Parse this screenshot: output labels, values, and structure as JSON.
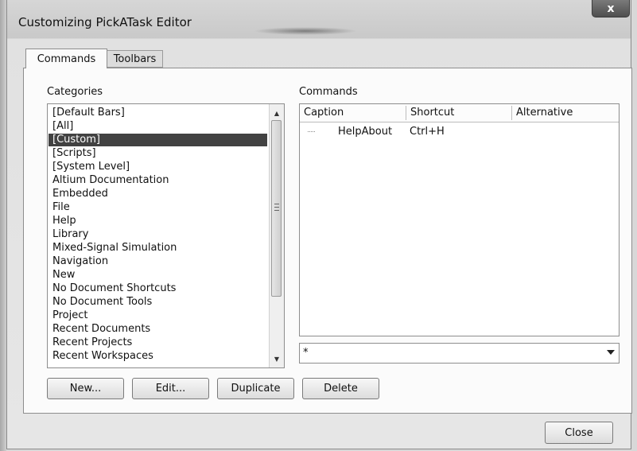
{
  "window": {
    "title": "Customizing PickATask Editor",
    "close_glyph": "x"
  },
  "tabs": [
    {
      "label": "Commands",
      "active": true
    },
    {
      "label": "Toolbars",
      "active": false
    }
  ],
  "categories": {
    "label": "Categories",
    "items": [
      "[Default Bars]",
      "[All]",
      "[Custom]",
      "[Scripts]",
      "[System Level]",
      "Altium Documentation",
      "Embedded",
      "File",
      "Help",
      "Library",
      "Mixed-Signal Simulation",
      "Navigation",
      "New",
      "No Document Shortcuts",
      "No Document Tools",
      "Project",
      "Recent Documents",
      "Recent Projects",
      "Recent Workspaces"
    ],
    "selected_index": 2
  },
  "commands": {
    "label": "Commands",
    "columns": [
      "Caption",
      "Shortcut",
      "Alternative"
    ],
    "rows": [
      {
        "caption": "HelpAbout",
        "shortcut": "Ctrl+H",
        "alternative": ""
      }
    ],
    "filter_value": "*"
  },
  "buttons": {
    "new": "New...",
    "edit": "Edit...",
    "duplicate": "Duplicate",
    "delete": "Delete",
    "close": "Close"
  },
  "icons": [
    "close-icon",
    "scroll-up-arrow-icon",
    "scroll-down-arrow-icon",
    "dropdown-arrow-icon"
  ]
}
